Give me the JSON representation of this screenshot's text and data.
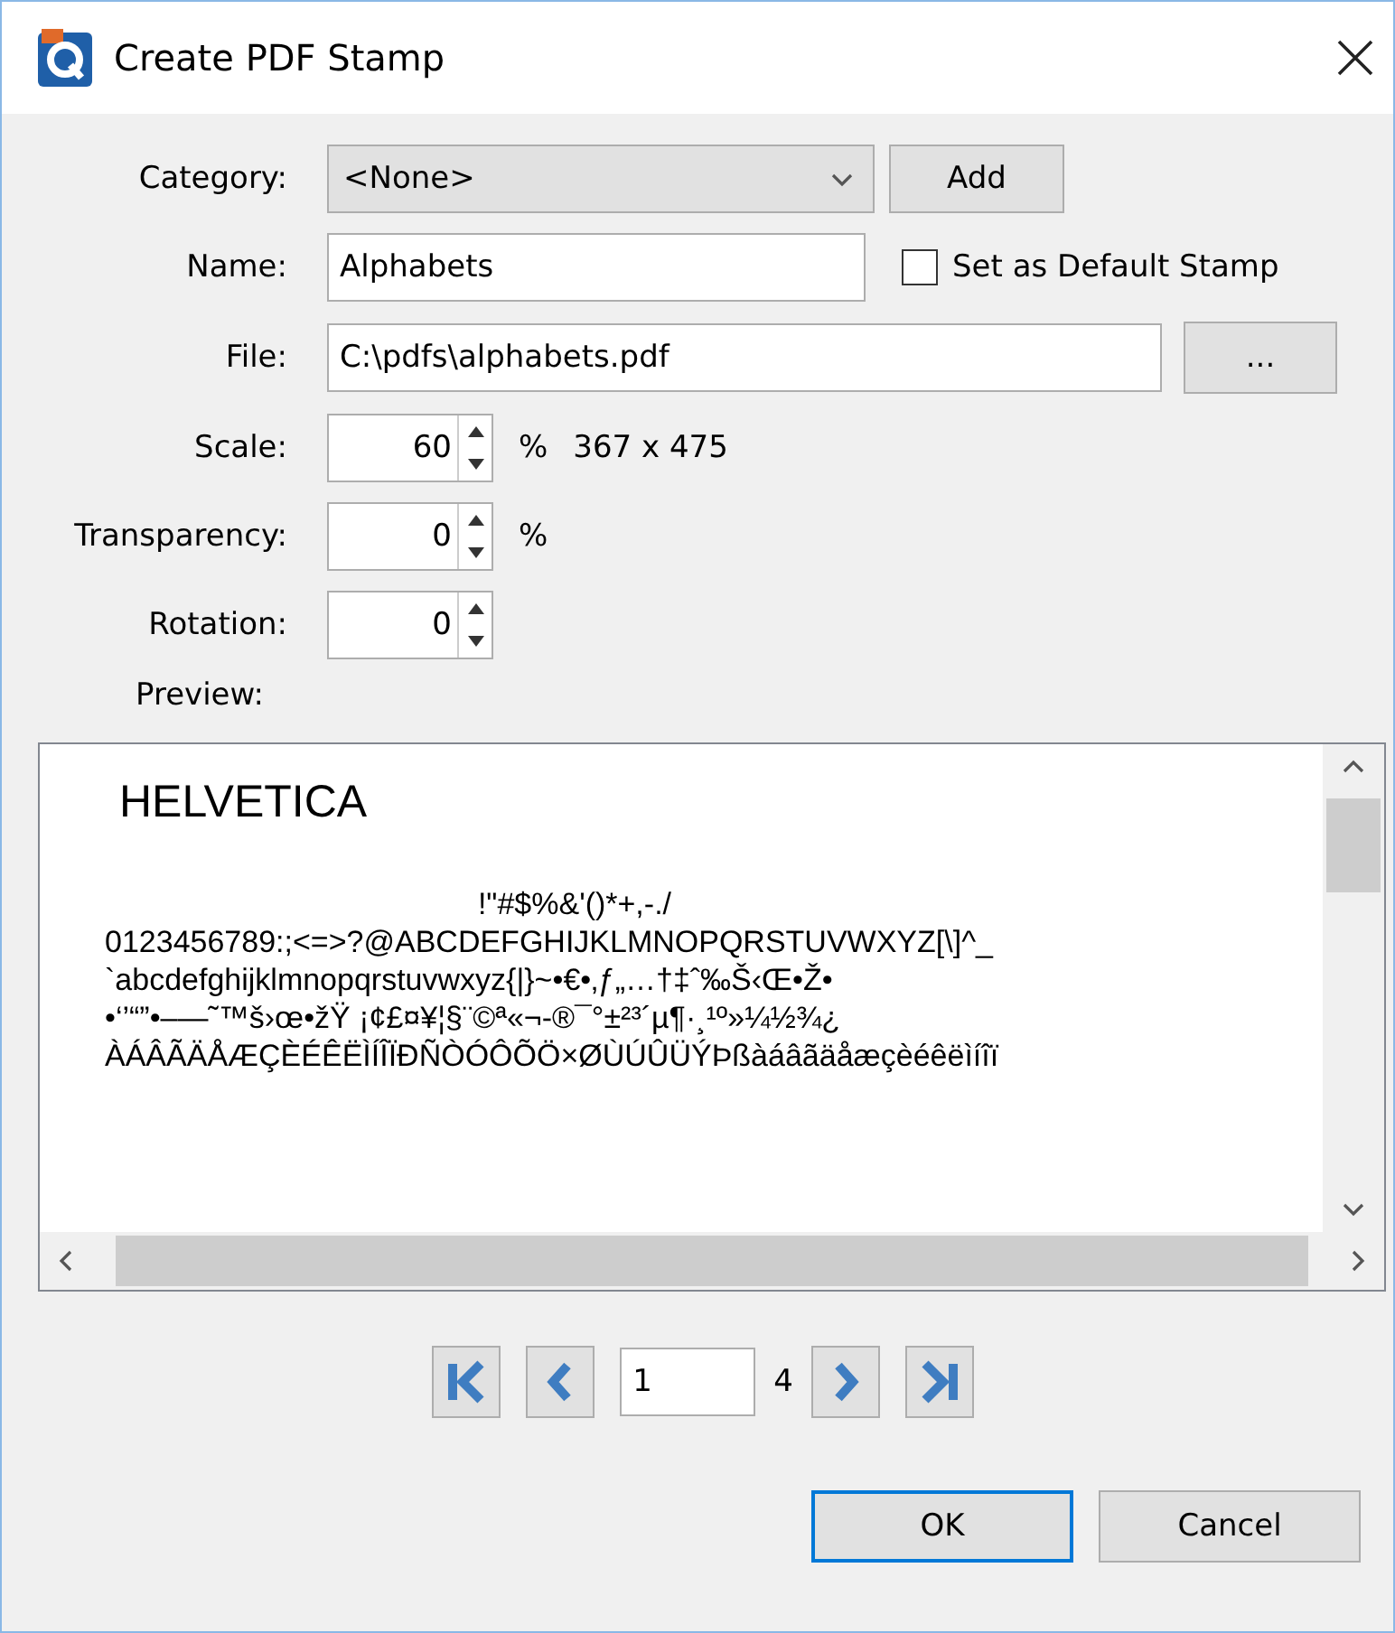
{
  "window": {
    "title": "Create PDF Stamp"
  },
  "category": {
    "label": "Category:",
    "value": "<None>",
    "add_button": "Add"
  },
  "name": {
    "label": "Name:",
    "value": "Alphabets",
    "default_stamp": {
      "label": "Set as Default Stamp",
      "checked": false
    }
  },
  "file": {
    "label": "File:",
    "value": "C:\\pdfs\\alphabets.pdf",
    "browse_button": "..."
  },
  "scale": {
    "label": "Scale:",
    "value": "60",
    "unit": "%",
    "dimensions": "367 x 475"
  },
  "transparency": {
    "label": "Transparency:",
    "value": "0",
    "unit": "%"
  },
  "rotation": {
    "label": "Rotation:",
    "value": "0"
  },
  "preview": {
    "label": "Preview:",
    "heading": "HELVETICA",
    "lines": [
      "!\"#$%&'()*+,-./",
      "0123456789:;<=>?@ABCDEFGHIJKLMNOPQRSTUVWXYZ[\\]^_",
      "`abcdefghijklmnopqrstuvwxyz{|}~•€•‚ƒ„…†‡ˆ‰Š‹Œ•Ž•",
      "•‘’“”•–—˜™š›œ•žŸ ¡¢£¤¥¦§¨©ª«¬-®¯°±²³´µ¶·¸¹º»¼½¾¿",
      "ÀÁÂÃÄÅÆÇÈÉÊËÌÍÎÏÐÑÒÓÔÕÖ×ØÙÚÛÜÝÞßàáâãäåæçèéêëìíîï"
    ]
  },
  "pager": {
    "page": "1",
    "total": "4"
  },
  "buttons": [
    {
      "label": "OK",
      "default": true
    },
    {
      "label": "Cancel",
      "default": false
    }
  ]
}
